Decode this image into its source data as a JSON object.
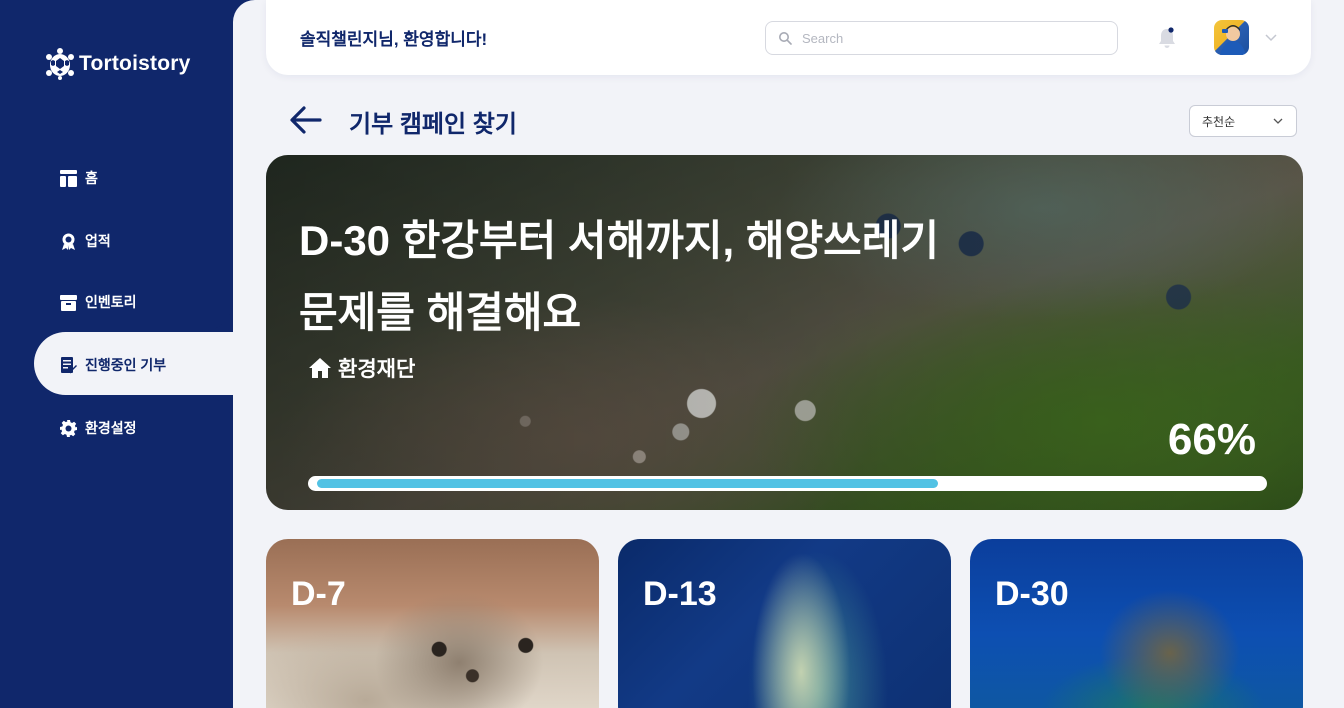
{
  "app": {
    "name": "Tortoistory"
  },
  "header": {
    "welcome": "솔직챌린지님, 환영합니다!",
    "search_placeholder": "Search"
  },
  "sidebar": {
    "items": [
      {
        "label": "홈",
        "icon": "home-layout-icon"
      },
      {
        "label": "업적",
        "icon": "award-icon"
      },
      {
        "label": "인벤토리",
        "icon": "archive-box-icon"
      },
      {
        "label": "진행중인 기부",
        "icon": "document-edit-icon",
        "active": true
      },
      {
        "label": "환경설정",
        "icon": "gear-icon"
      }
    ]
  },
  "page": {
    "title": "기부 캠페인 찾기",
    "sort": {
      "selected": "추천순"
    }
  },
  "hero": {
    "title_line1": "D-30 한강부터 서해까지, 해양쓰레기",
    "title_line2": "문제를 해결해요",
    "organization": "환경재단",
    "percent_label": "66%",
    "progress": 0.66
  },
  "cards": [
    {
      "dday": "D-7"
    },
    {
      "dday": "D-13"
    },
    {
      "dday": "D-30"
    }
  ],
  "colors": {
    "brand_navy": "#10276b",
    "background": "#f2f3f8",
    "progress_fill": "#52c2e4"
  }
}
